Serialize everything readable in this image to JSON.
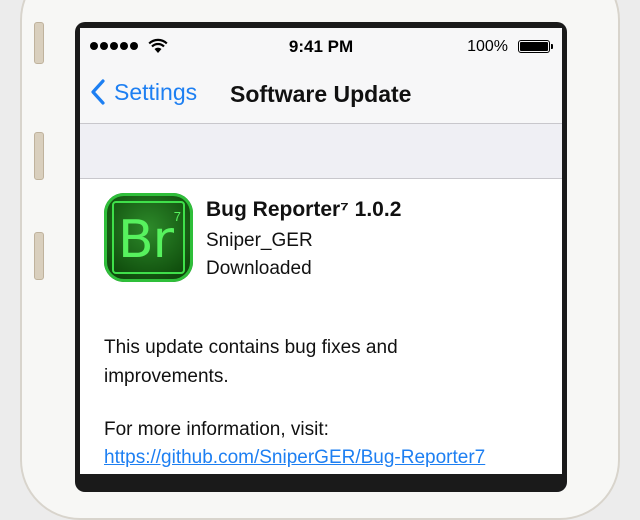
{
  "status_bar": {
    "time": "9:41 PM",
    "battery_percent": "100%",
    "signal_bars": 5,
    "battery_level": 1.0
  },
  "nav": {
    "back_label": "Settings",
    "title": "Software Update"
  },
  "update": {
    "app_name": "Bug Reporter⁷ 1.0.2",
    "icon_text": "Br",
    "icon_superscript": "7",
    "author": "Sniper_GER",
    "status": "Downloaded",
    "description_line1": "This update contains bug fixes and",
    "description_line2": "improvements.",
    "more_info": "For more information, visit:",
    "link": "https://github.com/SniperGER/Bug-Reporter7"
  },
  "colors": {
    "accent": "#1d7ff2",
    "icon_green": "#57f25e",
    "group_bg": "#efeff4"
  }
}
